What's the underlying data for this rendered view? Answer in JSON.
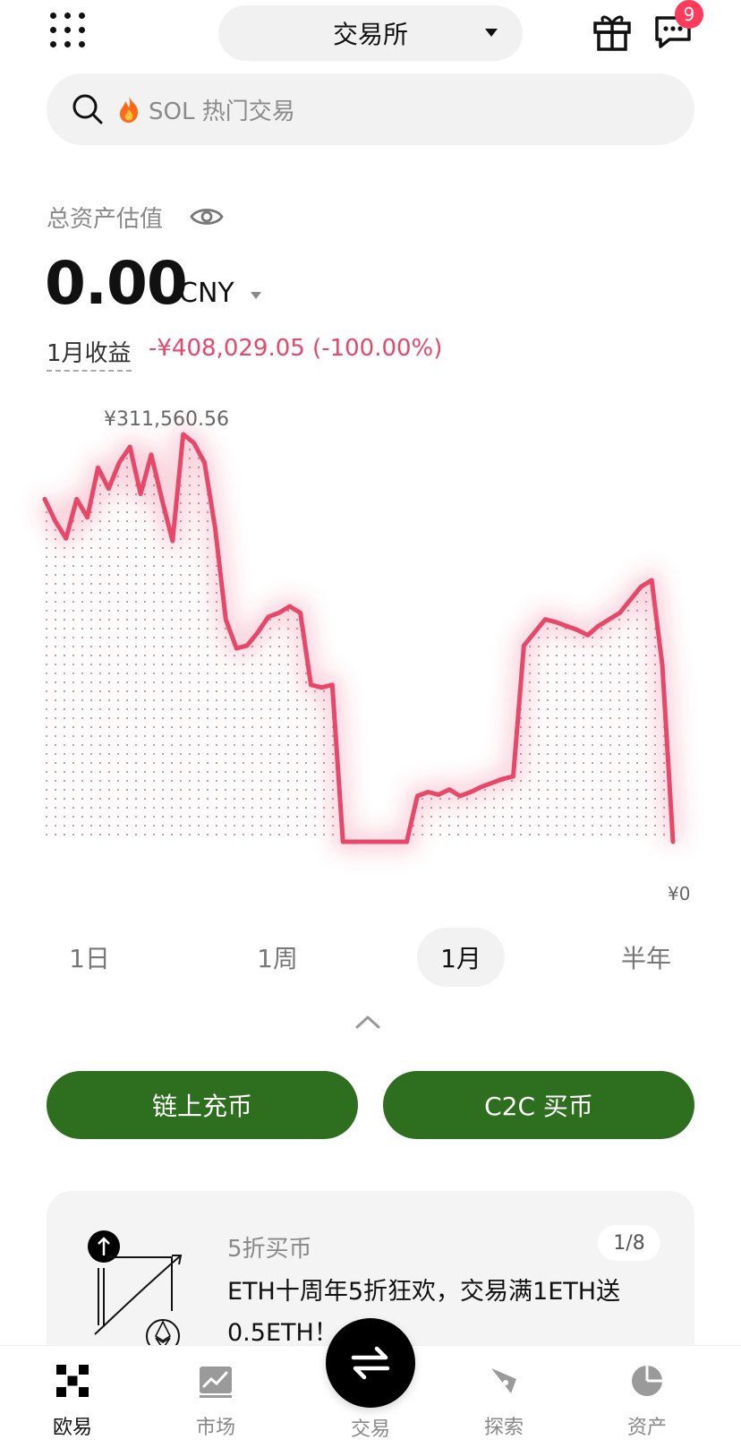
{
  "header": {
    "mode_label": "交易所",
    "notification_count": "9",
    "menu_icon": "grid-icon",
    "gift_icon": "gift-icon",
    "message_icon": "chat-icon"
  },
  "search": {
    "placeholder": "SOL 热门交易",
    "icon": "search-icon",
    "hot_icon": "fire-icon"
  },
  "balance": {
    "label": "总资产估值",
    "value": "0.00",
    "currency": "CNY",
    "pnl_label": "1月收益",
    "pnl_value": "-¥408,029.05 (-100.00%)"
  },
  "chart": {
    "max_label": "¥311,560.56",
    "min_label": "¥0",
    "line_color": "#e8476a",
    "ranges": [
      "1日",
      "1周",
      "1月",
      "半年"
    ],
    "active_range": "1月"
  },
  "chart_data": {
    "type": "area",
    "title": "",
    "xlabel": "",
    "ylabel": "",
    "ylim": [
      0,
      311560.56
    ],
    "x": [
      0,
      1,
      2,
      3,
      4,
      5,
      6,
      7,
      8,
      9,
      10,
      11,
      12,
      13,
      14,
      15,
      16,
      17,
      18,
      19,
      20,
      21,
      22,
      23,
      24,
      25,
      26,
      27,
      28,
      29,
      30,
      31,
      32,
      33,
      34,
      35,
      36,
      37,
      38,
      39,
      40,
      41,
      42,
      43,
      44,
      45,
      46,
      47,
      48,
      49,
      50,
      51,
      52,
      53,
      54,
      55,
      56,
      57,
      58,
      59
    ],
    "series": [
      {
        "values": [
          262000,
          245000,
          232000,
          262000,
          248000,
          286000,
          270000,
          290000,
          302000,
          266000,
          296000,
          262000,
          230000,
          311560,
          305000,
          290000,
          240000,
          170000,
          148000,
          150000,
          160000,
          172000,
          175000,
          180000,
          175000,
          120000,
          118000,
          120000,
          0,
          0,
          0,
          0,
          0,
          0,
          0,
          35000,
          38000,
          36000,
          40000,
          35000,
          38000,
          42000,
          45000,
          48000,
          50000,
          150000,
          160000,
          170000,
          168000,
          165000,
          162000,
          158000,
          165000,
          170000,
          175000,
          185000,
          195000,
          200000,
          135000,
          0
        ]
      }
    ]
  },
  "actions": {
    "deposit_label": "链上充币",
    "c2c_label": "C2C 买币"
  },
  "promo": {
    "title": "5折买币",
    "pager": "1/8",
    "text": "ETH十周年5折狂欢，交易满1ETH送0.5ETH！"
  },
  "nav": {
    "items": [
      {
        "label": "欧易",
        "icon": "okx-logo-icon"
      },
      {
        "label": "市场",
        "icon": "market-chart-icon"
      },
      {
        "label": "交易",
        "icon": "swap-arrows-icon"
      },
      {
        "label": "探索",
        "icon": "compass-icon"
      },
      {
        "label": "资产",
        "icon": "pie-chart-icon"
      }
    ]
  }
}
